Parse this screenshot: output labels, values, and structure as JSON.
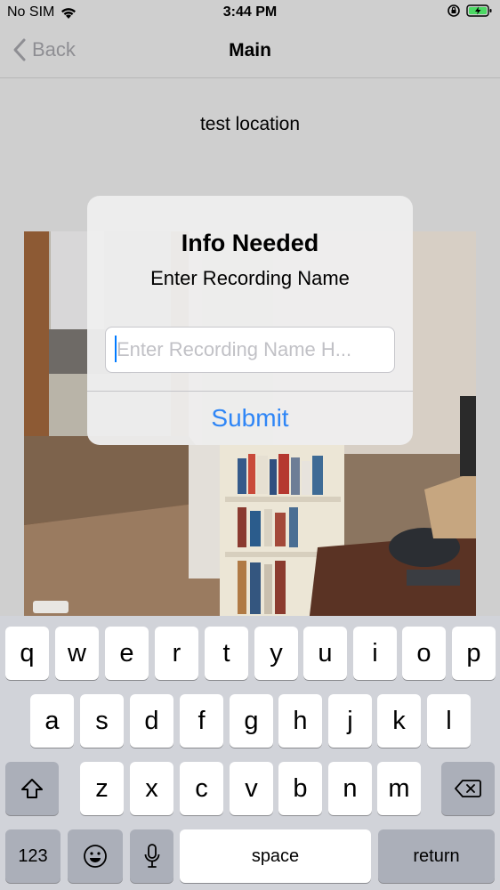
{
  "status_bar": {
    "carrier": "No SIM",
    "time": "3:44 PM"
  },
  "nav": {
    "back_label": "Back",
    "title": "Main"
  },
  "content": {
    "location_label": "test location"
  },
  "alert": {
    "title": "Info Needed",
    "message": "Enter Recording Name",
    "input_placeholder": "Enter Recording Name H...",
    "input_value": "",
    "submit_label": "Submit"
  },
  "keyboard": {
    "row1": [
      "q",
      "w",
      "e",
      "r",
      "t",
      "y",
      "u",
      "i",
      "o",
      "p"
    ],
    "row2": [
      "a",
      "s",
      "d",
      "f",
      "g",
      "h",
      "j",
      "k",
      "l"
    ],
    "row3": [
      "z",
      "x",
      "c",
      "v",
      "b",
      "n",
      "m"
    ],
    "numbers_label": "123",
    "space_label": "space",
    "return_label": "return"
  },
  "colors": {
    "accent": "#007aff",
    "background": "#cfcfcf",
    "keyboard": "#d1d3d9"
  }
}
